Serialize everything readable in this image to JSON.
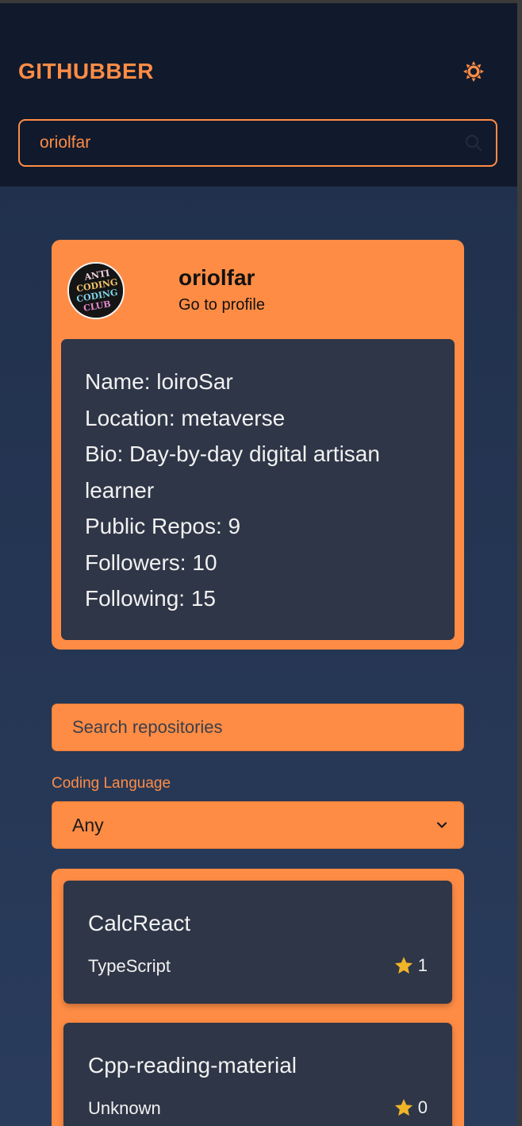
{
  "header": {
    "brand": "GITHUBBER",
    "theme_icon": "sun-icon",
    "search": {
      "value": "oriolfar",
      "icon": "search-icon"
    }
  },
  "profile": {
    "avatar_text": [
      "ANTI",
      "CODING",
      "CODING",
      "CLUB"
    ],
    "username": "oriolfar",
    "profile_link": "Go to profile",
    "details": [
      "Name: loiroSar",
      "Location: metaverse",
      "Bio: Day-by-day digital artisan learner",
      "Public Repos: 9",
      "Followers: 10",
      "Following: 15"
    ]
  },
  "repo_filter": {
    "search_placeholder": "Search repositories",
    "language_label": "Coding Language",
    "language_selected": "Any"
  },
  "repos": [
    {
      "name": "CalcReact",
      "language": "TypeScript",
      "stars": "1"
    },
    {
      "name": "Cpp-reading-material",
      "language": "Unknown",
      "stars": "0"
    }
  ],
  "colors": {
    "accent": "#ff8c45",
    "header_bg": "#111a2c",
    "card_bg": "#2e3647",
    "star": "#f0b429"
  }
}
